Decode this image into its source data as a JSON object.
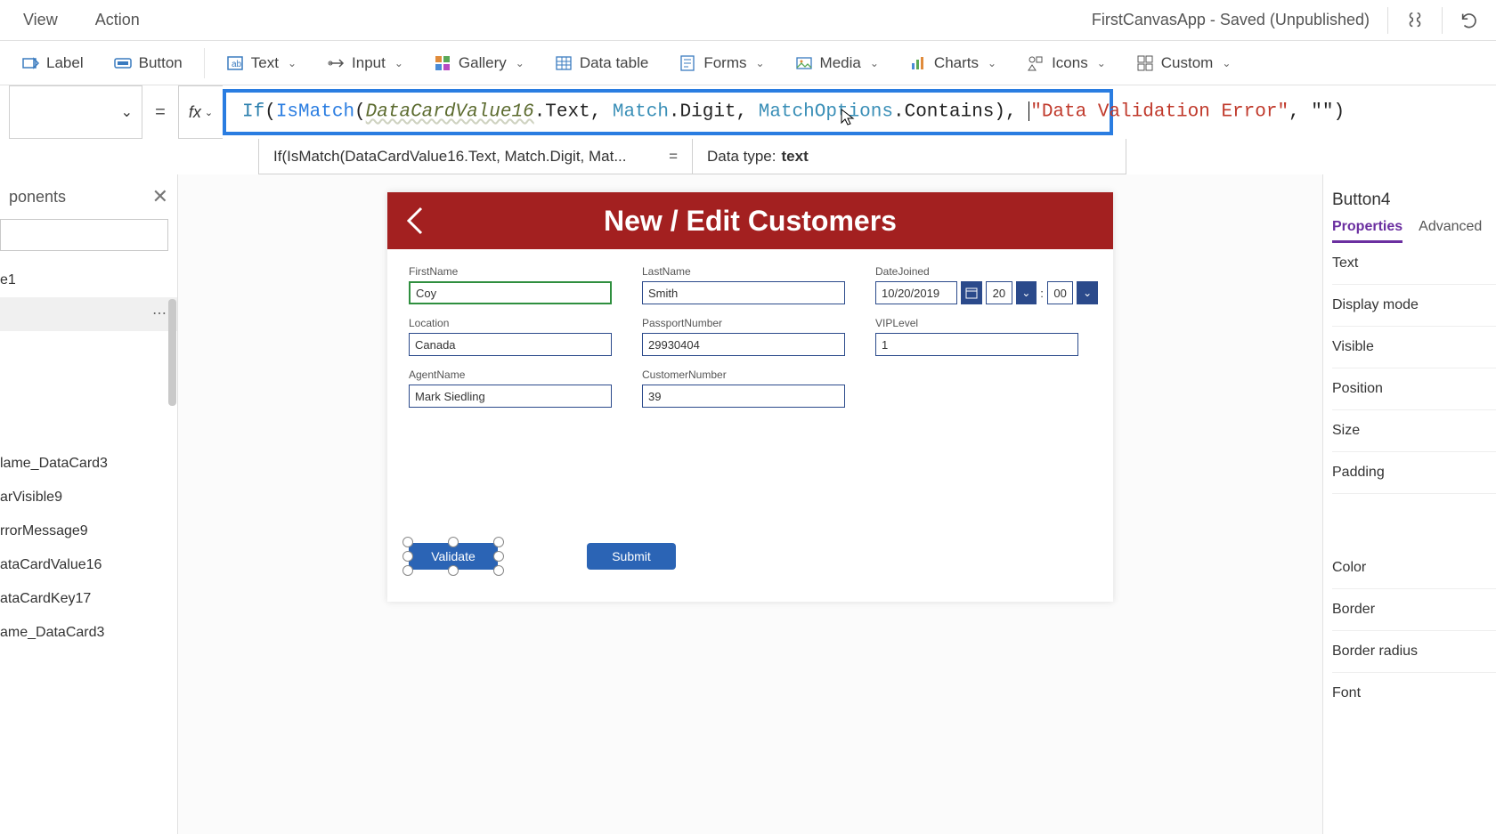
{
  "topbar": {
    "menus": [
      "View",
      "Action"
    ],
    "app_title": "FirstCanvasApp - Saved (Unpublished)"
  },
  "ribbon": {
    "label_btn": "Label",
    "button_btn": "Button",
    "text_btn": "Text",
    "input_btn": "Input",
    "gallery_btn": "Gallery",
    "datatable_btn": "Data table",
    "forms_btn": "Forms",
    "media_btn": "Media",
    "charts_btn": "Charts",
    "icons_btn": "Icons",
    "custom_btn": "Custom"
  },
  "formula": {
    "kw_if": "If",
    "fn_ismatch": "IsMatch",
    "var_datacard": "DataCardValue16",
    "dot_text": ".Text, ",
    "enum_match": "Match",
    "dot_digit": ".Digit, ",
    "enum_opts": "MatchOptions",
    "dot_contains": ".Contains), ",
    "str_err": "\"Data Validation Error\"",
    "str_empty": ", \"\")",
    "open1": "(",
    "open2": "("
  },
  "result": {
    "left": "If(IsMatch(DataCardValue16.Text, Match.Digit, Mat...",
    "equals": "=",
    "right_label": "Data type:",
    "right_value": "text"
  },
  "tree": {
    "tab": "ponents",
    "item1": "e1",
    "items_bottom": [
      "lame_DataCard3",
      "arVisible9",
      "rrorMessage9",
      "ataCardValue16",
      "ataCardKey17",
      "ame_DataCard3"
    ]
  },
  "canvas": {
    "title": "New / Edit Customers",
    "fields": {
      "first_name_label": "FirstName",
      "first_name": "Coy",
      "last_name_label": "LastName",
      "last_name": "Smith",
      "date_label": "DateJoined",
      "date": "10/20/2019",
      "hour": "20",
      "minute": "00",
      "location_label": "Location",
      "location": "Canada",
      "passport_label": "PassportNumber",
      "passport": "29930404",
      "vip_label": "VIPLevel",
      "vip": "1",
      "agent_label": "AgentName",
      "agent": "Mark Siedling",
      "custnum_label": "CustomerNumber",
      "custnum": "39"
    },
    "validate_btn": "Validate",
    "submit_btn": "Submit"
  },
  "props": {
    "selected": "Button4",
    "tab_properties": "Properties",
    "tab_advanced": "Advanced",
    "rows": [
      "Text",
      "Display mode",
      "Visible",
      "Position",
      "Size",
      "Padding",
      "Color",
      "Border",
      "Border radius",
      "Font"
    ]
  }
}
